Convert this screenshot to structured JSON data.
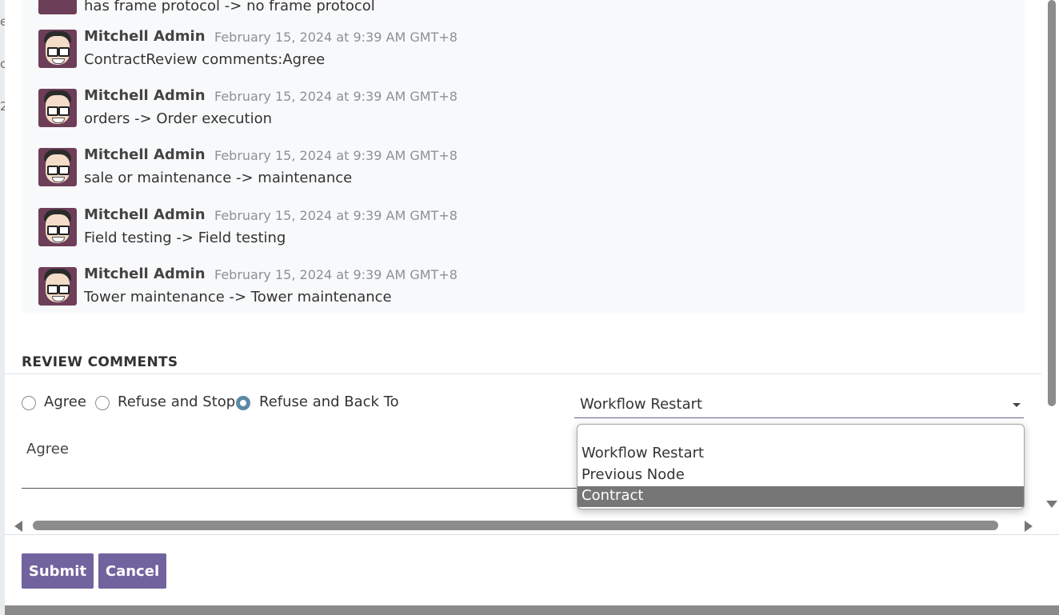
{
  "background": {
    "glyphs": [
      "e",
      "c",
      "2"
    ]
  },
  "messages": [
    {
      "author": "",
      "date": "",
      "body": "has frame protocol -> no frame protocol"
    },
    {
      "author": "Mitchell Admin",
      "date": "February 15, 2024 at 9:39 AM GMT+8",
      "body": "ContractReview comments:Agree"
    },
    {
      "author": "Mitchell Admin",
      "date": "February 15, 2024 at 9:39 AM GMT+8",
      "body": "orders -> Order execution"
    },
    {
      "author": "Mitchell Admin",
      "date": "February 15, 2024 at 9:39 AM GMT+8",
      "body": "sale or maintenance -> maintenance"
    },
    {
      "author": "Mitchell Admin",
      "date": "February 15, 2024 at 9:39 AM GMT+8",
      "body": "Field testing -> Field testing"
    },
    {
      "author": "Mitchell Admin",
      "date": "February 15, 2024 at 9:39 AM GMT+8",
      "body": "Tower maintenance -> Tower maintenance"
    }
  ],
  "review": {
    "title": "REVIEW COMMENTS",
    "options": [
      {
        "label": "Agree",
        "checked": false
      },
      {
        "label": "Refuse and Stop",
        "checked": false
      },
      {
        "label": "Refuse and Back To",
        "checked": true
      }
    ],
    "back_to_select": {
      "value": "Workflow Restart",
      "options": [
        "",
        "Workflow Restart",
        "Previous Node",
        "Contract"
      ],
      "highlighted": "Contract"
    },
    "comment_value": "Agree"
  },
  "footer": {
    "submit_label": "Submit",
    "cancel_label": "Cancel"
  },
  "colors": {
    "primary_button": "#71639e",
    "radio_checked": "#5b89a6",
    "chatter_bg": "#f8f9fa",
    "option_highlight": "#767676"
  }
}
